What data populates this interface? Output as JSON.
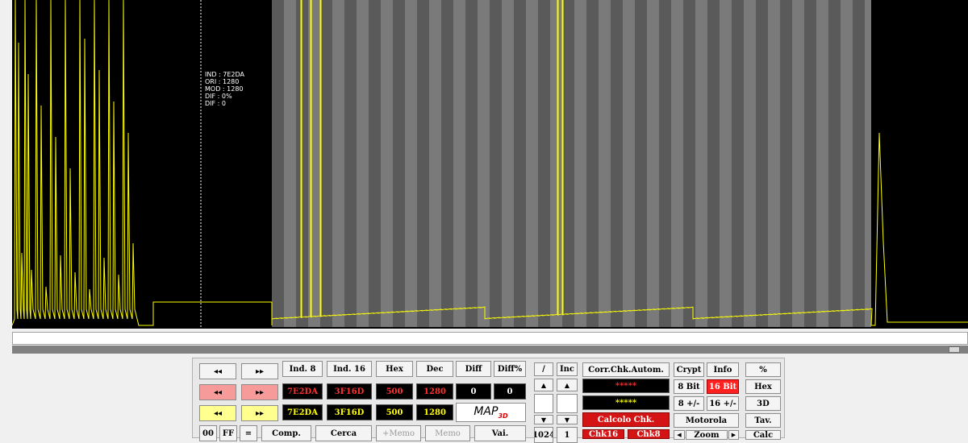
{
  "tooltip": {
    "lines": [
      "IND : 7E2DA",
      "ORI : 1280",
      "MOD : 1280",
      "DIF : 0%",
      "DIF : 0"
    ]
  },
  "nav": {
    "rewind_icon": "double-left-arrow",
    "forward_icon": "double-right-arrow",
    "rewind_glyph": "◂◂",
    "forward_glyph": "▸▸"
  },
  "headers": {
    "ind8": "Ind. 8",
    "ind16": "Ind. 16",
    "hex": "Hex",
    "dec": "Dec",
    "diff": "Diff",
    "diff_pct": "Diff%"
  },
  "row_ori": {
    "ind8": "7E2DA",
    "ind16": "3F16D",
    "hex": "500",
    "dec": "1280",
    "diff": "0",
    "diff_pct": "0"
  },
  "row_mod": {
    "ind8": "7E2DA",
    "ind16": "3F16D",
    "hex": "500",
    "dec": "1280"
  },
  "map_logo": {
    "main": "MAP",
    "sub": "3D"
  },
  "bottom_row": {
    "b00": "00",
    "bff": "FF",
    "eq": "=",
    "comp": "Comp.",
    "cerca": "Cerca",
    "memo_plus": "+Memo",
    "memo": "Memo",
    "vai": "Vai."
  },
  "divider": {
    "label": "/",
    "value_bottom": "1024"
  },
  "inc": {
    "label": "Inc",
    "value_bottom": "1"
  },
  "checksum": {
    "title": "Corr.Chk.Autom.",
    "field1": "*****",
    "field2": "*****",
    "calc": "Calcolo Chk.",
    "chk16": "Chk16",
    "chk8": "Chk8"
  },
  "options": {
    "crypt": "Crypt",
    "info": "Info",
    "bit8": "8 Bit",
    "bit16": "16 Bit",
    "plusminus8": "8 +/-",
    "plusminus16": "16 +/-",
    "motorola": "Motorola",
    "zoom": "Zoom"
  },
  "right_col": {
    "pct": "%",
    "hex": "Hex",
    "threed": "3D",
    "tav": "Tav.",
    "calc": "Calc"
  },
  "colors": {
    "plot_bg": "#000000",
    "trace": "#ffff00",
    "stripe_a": "#5a5a5a",
    "stripe_b": "#7a7a7a"
  }
}
